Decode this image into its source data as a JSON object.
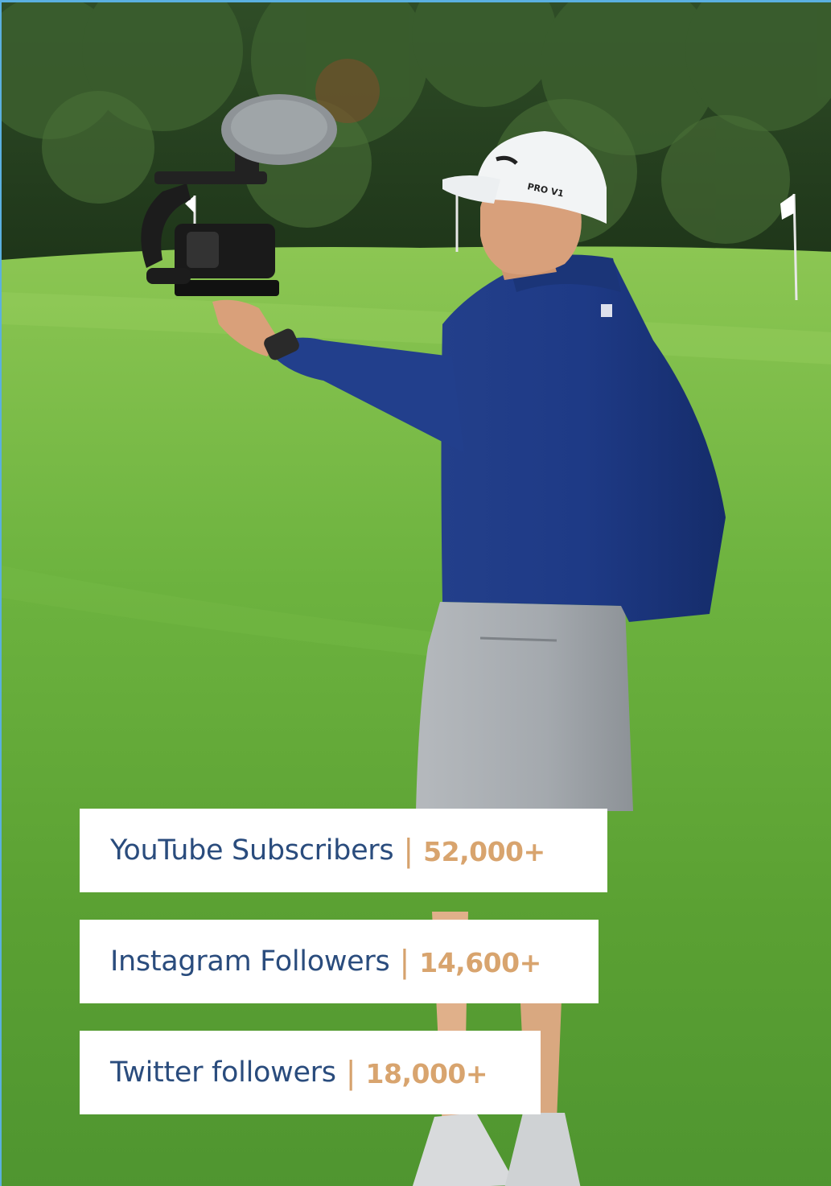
{
  "photo": {
    "subject": "golfer-with-camera",
    "cap_text": "PRO V1",
    "colors": {
      "sky": "#5ab0e0",
      "trees": "#2c4a24",
      "grass": "#6fb843",
      "jacket": "#1e3f8c",
      "shorts": "#a9aeb3",
      "cap": "#f2f4f5"
    }
  },
  "stats": [
    {
      "label": "YouTube Subscribers",
      "separator": "|",
      "value": "52,000+"
    },
    {
      "label": "Instagram Followers",
      "separator": "|",
      "value": "14,600+"
    },
    {
      "label": "Twitter followers",
      "separator": "|",
      "value": "18,000+"
    }
  ],
  "colors": {
    "label": "#2a4c7d",
    "value": "#d8a46e",
    "card_bg": "#ffffff"
  }
}
